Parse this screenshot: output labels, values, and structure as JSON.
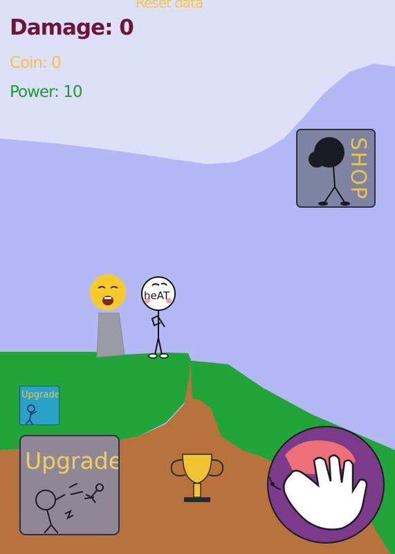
{
  "hud": {
    "reset_label": "Reset data",
    "damage_label": "Damage: 0",
    "coin_label": "Coin: 0",
    "power_label": "Power: 10"
  },
  "shop": {
    "label": "SHOP"
  },
  "upgrades": {
    "small_label": "Upgrade",
    "big_label": "Upgrade"
  },
  "target": {
    "speech_label": "heAT"
  },
  "icons": {
    "trophy": "trophy-icon",
    "hit": "slap-hand-icon"
  },
  "colors": {
    "sky": "#b4b8f4",
    "hill": "#dedff8",
    "grass": "#21a43a",
    "dirt": "#b8723c",
    "damage": "#6e1538",
    "coin": "#f2c34a",
    "power": "#1d9a34",
    "hit_button_ring": "#7b3a8a"
  }
}
